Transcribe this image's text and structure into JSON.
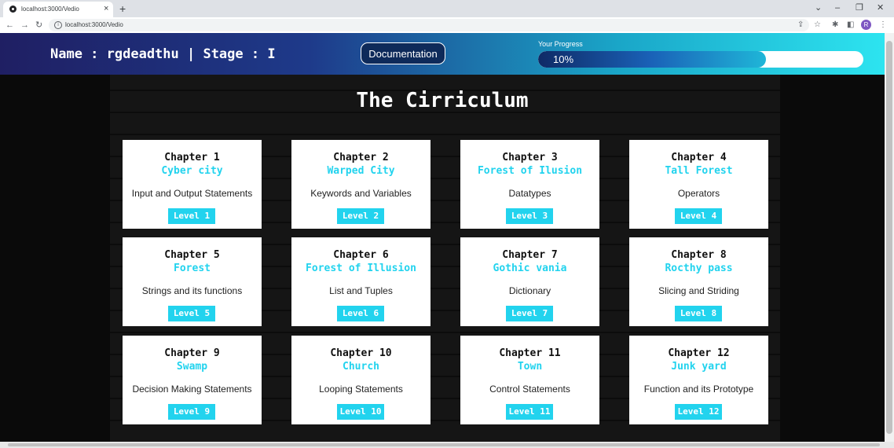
{
  "browser": {
    "tab_title": "localhost:3000/Vedio",
    "tab_close": "×",
    "new_tab": "+",
    "url": "localhost:3000/Vedio",
    "profile_initial": "R"
  },
  "header": {
    "user_line": "Name : rgdeadthu | Stage : I",
    "documentation_label": "Documentation",
    "progress_label": "Your Progress",
    "progress_text": "10%",
    "progress_fraction": 0.1
  },
  "curriculum_title": "The Cirriculum",
  "colors": {
    "accent": "#22d3ee",
    "header_start": "#1f1f63",
    "header_end": "#2de4f0"
  },
  "chapters": [
    {
      "chapter": "Chapter 1",
      "place": "Cyber city",
      "topic": "Input and Output Statements",
      "level": "Level 1"
    },
    {
      "chapter": "Chapter 2",
      "place": "Warped City",
      "topic": "Keywords and Variables",
      "level": "Level 2"
    },
    {
      "chapter": "Chapter 3",
      "place": "Forest of Ilusion",
      "topic": "Datatypes",
      "level": "Level 3"
    },
    {
      "chapter": "Chapter 4",
      "place": "Tall Forest",
      "topic": "Operators",
      "level": "Level 4"
    },
    {
      "chapter": "Chapter 5",
      "place": "Forest",
      "topic": "Strings and its functions",
      "level": "Level 5"
    },
    {
      "chapter": "Chapter 6",
      "place": "Forest of Illusion",
      "topic": "List and Tuples",
      "level": "Level 6"
    },
    {
      "chapter": "Chapter 7",
      "place": "Gothic vania",
      "topic": "Dictionary",
      "level": "Level 7"
    },
    {
      "chapter": "Chapter 8",
      "place": "Rocthy pass",
      "topic": "Slicing and Striding",
      "level": "Level 8"
    },
    {
      "chapter": "Chapter 9",
      "place": "Swamp",
      "topic": "Decision Making Statements",
      "level": "Level 9"
    },
    {
      "chapter": "Chapter 10",
      "place": "Church",
      "topic": "Looping Statements",
      "level": "Level 10"
    },
    {
      "chapter": "Chapter 11",
      "place": "Town",
      "topic": "Control Statements",
      "level": "Level 11"
    },
    {
      "chapter": "Chapter 12",
      "place": "Junk yard",
      "topic": "Function and its Prototype",
      "level": "Level 12"
    }
  ]
}
